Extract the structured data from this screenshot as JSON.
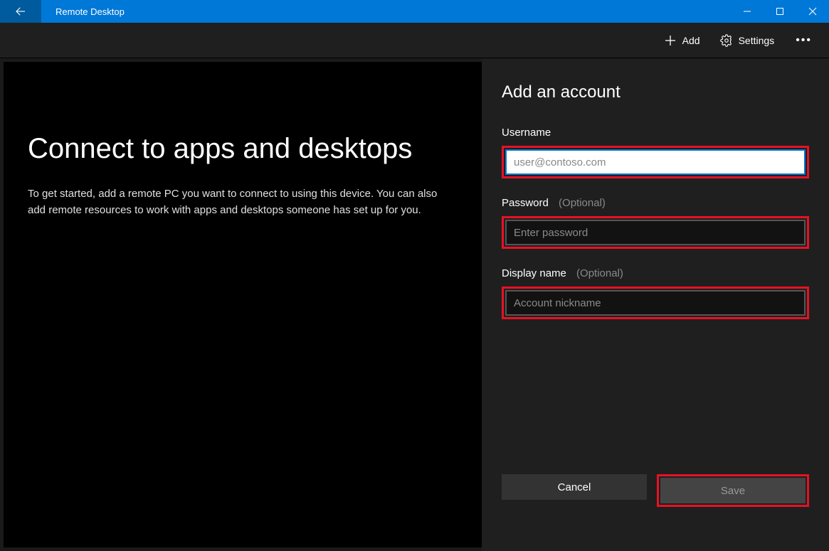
{
  "titlebar": {
    "app_title": "Remote Desktop"
  },
  "command_bar": {
    "add_label": "Add",
    "settings_label": "Settings"
  },
  "main": {
    "title": "Connect to apps and desktops",
    "description": "To get started, add a remote PC you want to connect to using this device. You can also add remote resources to work with apps and desktops someone has set up for you."
  },
  "panel": {
    "title": "Add an account",
    "username": {
      "label": "Username",
      "placeholder": "user@contoso.com",
      "value": ""
    },
    "password": {
      "label": "Password",
      "optional": "(Optional)",
      "placeholder": "Enter password",
      "value": ""
    },
    "display_name": {
      "label": "Display name",
      "optional": "(Optional)",
      "placeholder": "Account nickname",
      "value": ""
    },
    "cancel_label": "Cancel",
    "save_label": "Save"
  }
}
